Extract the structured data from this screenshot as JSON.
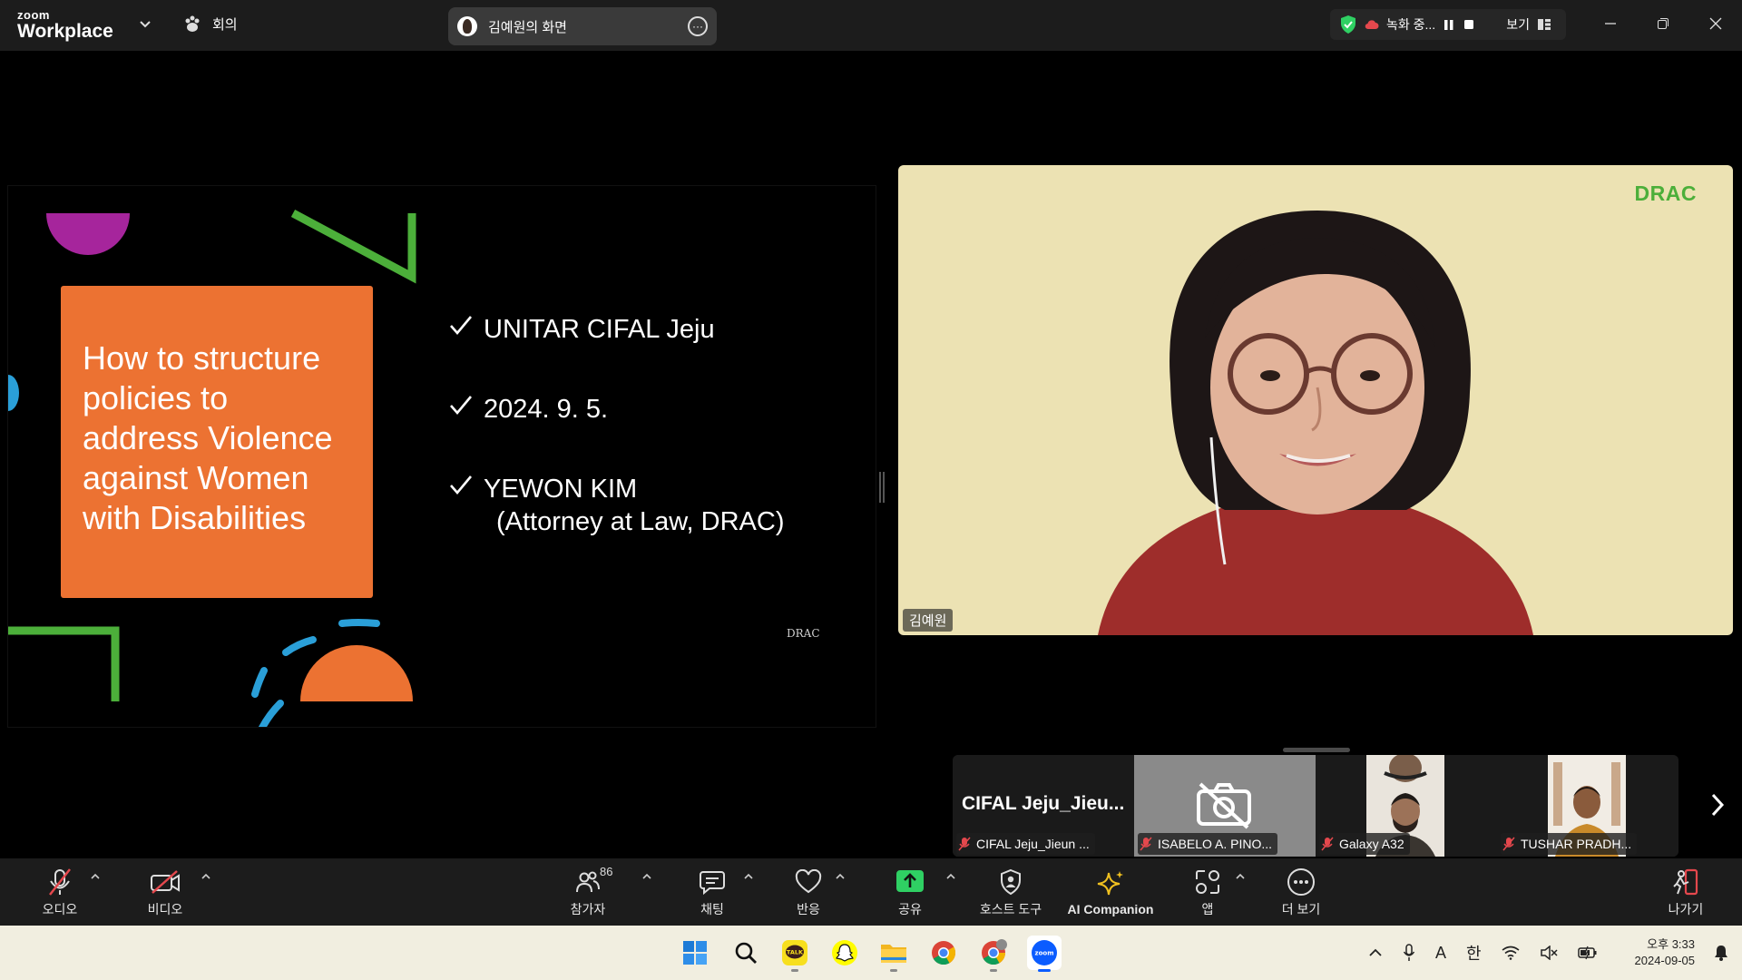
{
  "titlebar": {
    "logo_top": "zoom",
    "logo_bottom": "Workplace",
    "meeting_label": "회의",
    "share_label": "김예원의 화면",
    "recording_label": "녹화 중...",
    "view_label": "보기"
  },
  "slide": {
    "card_title": "How to structure policies to address Violence against Women with Disabilities",
    "bullets": [
      {
        "text": "UNITAR CIFAL Jeju",
        "sub": ""
      },
      {
        "text": "2024. 9. 5.",
        "sub": ""
      },
      {
        "text": "YEWON KIM",
        "sub": "(Attorney at Law, DRAC)"
      }
    ],
    "mark": "DRAC"
  },
  "speaker": {
    "brand": "DRAC",
    "name": "김예원"
  },
  "thumbnails": [
    {
      "big_name": "CIFAL  Jeju_Jieu...",
      "label": "CIFAL Jeju_Jieun ..."
    },
    {
      "big_name": "",
      "label": "ISABELO A. PINO..."
    },
    {
      "big_name": "",
      "label": "Galaxy A32"
    },
    {
      "big_name": "",
      "label": "TUSHAR PRADH..."
    }
  ],
  "toolbar": {
    "audio": "오디오",
    "video": "비디오",
    "participants": "참가자",
    "participants_count": "86",
    "chat": "채팅",
    "reactions": "반응",
    "share": "공유",
    "host_tools": "호스트 도구",
    "ai_companion": "AI Companion",
    "apps": "앱",
    "more": "더 보기",
    "leave": "나가기"
  },
  "taskbar": {
    "ime_a": "A",
    "ime_lang": "한",
    "time": "오후 3:33",
    "date": "2024-09-05"
  },
  "colors": {
    "card_orange": "#ec7232",
    "speaker_bg": "#ece2b3",
    "brand_green": "#4caf3a",
    "share_green": "#2fd063",
    "mute_red": "#e5484d"
  }
}
